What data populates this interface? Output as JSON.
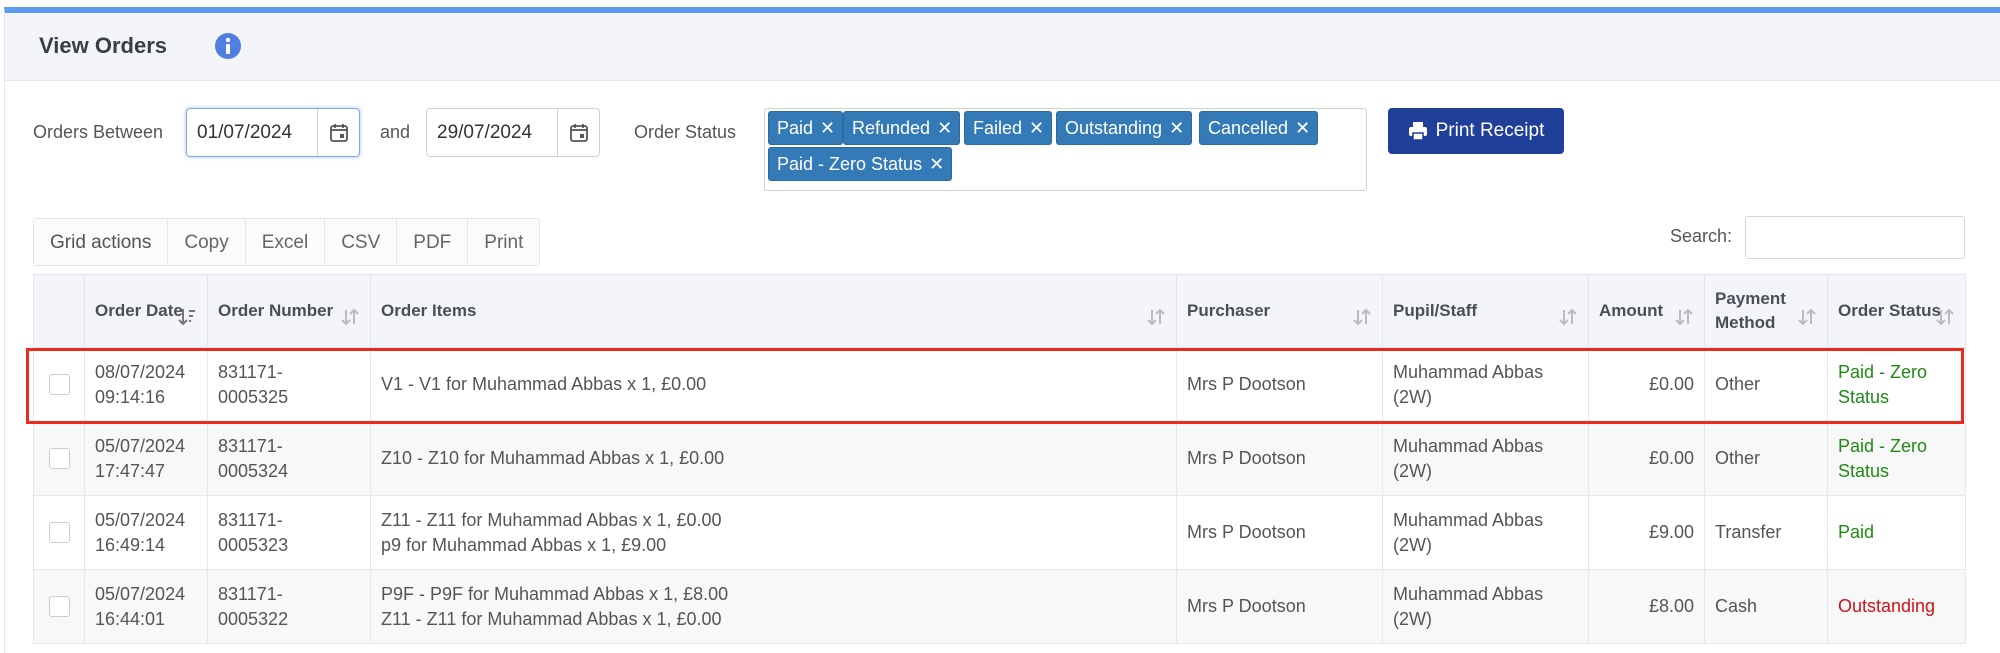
{
  "header": {
    "title": "View Orders",
    "info_icon": "info-circle-icon"
  },
  "filters": {
    "orders_between_label": "Orders Between",
    "from_date": "01/07/2024",
    "and_label": "and",
    "to_date": "29/07/2024",
    "order_status_label": "Order Status",
    "status_tags": [
      "Paid",
      "Refunded",
      "Failed",
      "Outstanding",
      "Cancelled",
      "Paid - Zero Status"
    ],
    "tag_remove_glyph": "✕",
    "print_receipt_label": "Print Receipt"
  },
  "grid_actions": {
    "label": "Grid actions",
    "buttons": [
      "Copy",
      "Excel",
      "CSV",
      "PDF",
      "Print"
    ],
    "search_label": "Search:"
  },
  "table": {
    "columns": [
      {
        "label": ""
      },
      {
        "label": "Order Date"
      },
      {
        "label": "Order Number"
      },
      {
        "label": "Order Items"
      },
      {
        "label": "Purchaser"
      },
      {
        "label": "Pupil/Staff"
      },
      {
        "label": "Amount"
      },
      {
        "label": "Payment Method"
      },
      {
        "label": "Order Status"
      }
    ],
    "rows": [
      {
        "date": "08/07/2024",
        "time": "09:14:16",
        "number_a": "831171-",
        "number_b": "0005325",
        "items": [
          "V1 - V1 for Muhammad Abbas x 1, £0.00"
        ],
        "purchaser": "Mrs P Dootson",
        "pupil_a": "Muhammad Abbas",
        "pupil_b": "(2W)",
        "amount": "£0.00",
        "payment": "Other",
        "status": "Paid - Zero Status",
        "status_color": "#1f8a14"
      },
      {
        "date": "05/07/2024",
        "time": "17:47:47",
        "number_a": "831171-",
        "number_b": "0005324",
        "items": [
          "Z10 - Z10 for Muhammad Abbas x 1, £0.00"
        ],
        "purchaser": "Mrs P Dootson",
        "pupil_a": "Muhammad Abbas",
        "pupil_b": "(2W)",
        "amount": "£0.00",
        "payment": "Other",
        "status": "Paid - Zero Status",
        "status_color": "#1f8a14"
      },
      {
        "date": "05/07/2024",
        "time": "16:49:14",
        "number_a": "831171-",
        "number_b": "0005323",
        "items": [
          "Z11 - Z11 for Muhammad Abbas x 1, £0.00",
          "p9 for Muhammad Abbas x 1, £9.00"
        ],
        "purchaser": "Mrs P Dootson",
        "pupil_a": "Muhammad Abbas",
        "pupil_b": "(2W)",
        "amount": "£9.00",
        "payment": "Transfer",
        "status": "Paid",
        "status_color": "#1f8a14"
      },
      {
        "date": "05/07/2024",
        "time": "16:44:01",
        "number_a": "831171-",
        "number_b": "0005322",
        "items": [
          "P9F - P9F for Muhammad Abbas x 1, £8.00",
          "Z11 - Z11 for Muhammad Abbas x 1, £0.00"
        ],
        "purchaser": "Mrs P Dootson",
        "pupil_a": "Muhammad Abbas",
        "pupil_b": "(2W)",
        "amount": "£8.00",
        "payment": "Cash",
        "status": "Outstanding",
        "status_color": "#d0121a"
      }
    ]
  },
  "colors": {
    "accent_bar": "#5b9cf0",
    "tag_bg": "#337ab7",
    "primary_button": "#1f3f99",
    "highlight_border": "#e82a1f"
  }
}
